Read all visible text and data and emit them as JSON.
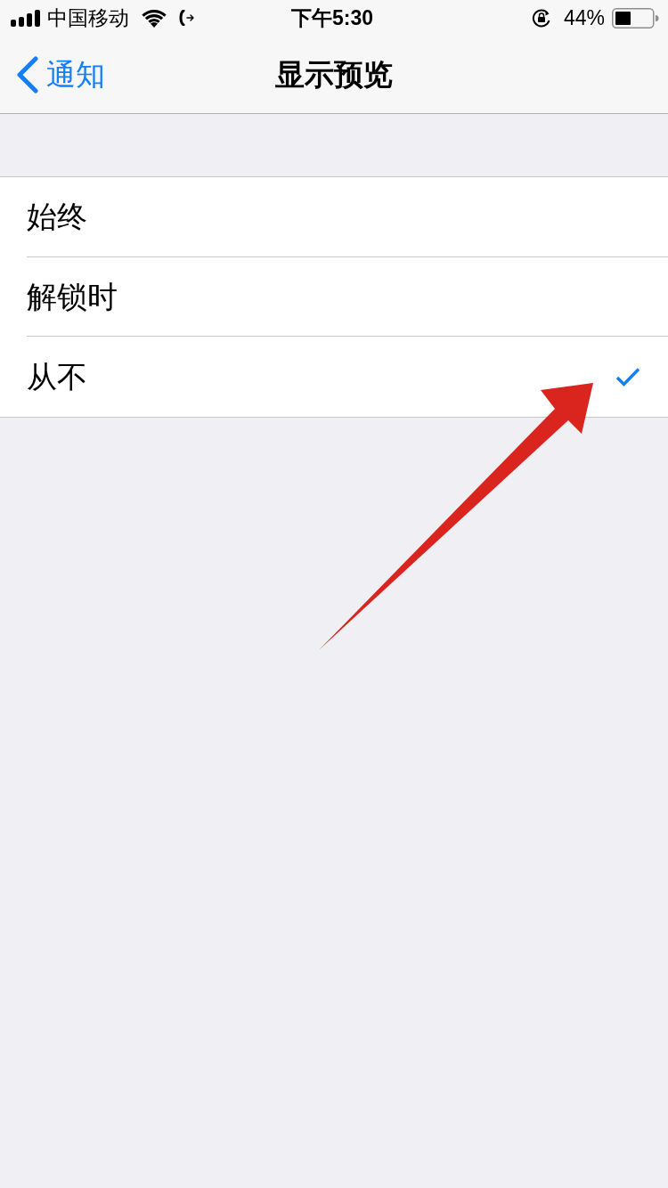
{
  "status_bar": {
    "carrier": "中国移动",
    "time": "下午5:30",
    "battery_percent": "44%"
  },
  "nav_bar": {
    "back_label": "通知",
    "title": "显示预览"
  },
  "options": [
    {
      "label": "始终",
      "selected": false
    },
    {
      "label": "解锁时",
      "selected": false
    },
    {
      "label": "从不",
      "selected": true
    }
  ]
}
